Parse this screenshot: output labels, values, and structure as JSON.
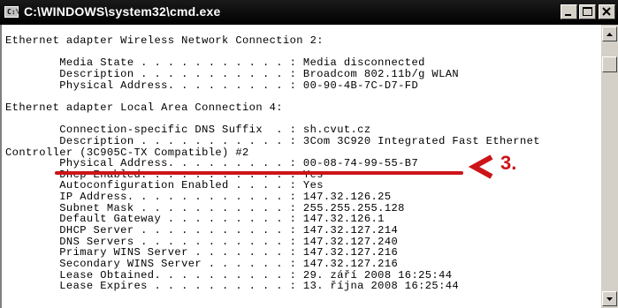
{
  "window": {
    "title": "C:\\WINDOWS\\system32\\cmd.exe",
    "icon": "cmd-icon",
    "icon_text": "C:\\"
  },
  "console": {
    "lines": [
      "Ethernet adapter Wireless Network Connection 2:",
      "",
      "        Media State . . . . . . . . . . . : Media disconnected",
      "        Description . . . . . . . . . . . : Broadcom 802.11b/g WLAN",
      "        Physical Address. . . . . . . . . : 00-90-4B-7C-D7-FD",
      "",
      "Ethernet adapter Local Area Connection 4:",
      "",
      "        Connection-specific DNS Suffix  . : sh.cvut.cz",
      "        Description . . . . . . . . . . . : 3Com 3C920 Integrated Fast Ethernet",
      "Controller (3C905C-TX Compatible) #2",
      "        Physical Address. . . . . . . . . : 00-08-74-99-55-B7",
      "        Dhcp Enabled. . . . . . . . . . . : Yes",
      "        Autoconfiguration Enabled . . . . : Yes",
      "        IP Address. . . . . . . . . . . . : 147.32.126.25",
      "        Subnet Mask . . . . . . . . . . . : 255.255.255.128",
      "        Default Gateway . . . . . . . . . : 147.32.126.1",
      "        DHCP Server . . . . . . . . . . . : 147.32.127.214",
      "        DNS Servers . . . . . . . . . . . : 147.32.127.240",
      "        Primary WINS Server . . . . . . . : 147.32.127.216",
      "        Secondary WINS Server . . . . . . : 147.32.127.216",
      "        Lease Obtained. . . . . . . . . . : 29. září 2008 16:25:44",
      "        Lease Expires . . . . . . . . . . : 13. října 2008 16:25:44"
    ]
  },
  "annotation": {
    "label": "3.",
    "color": "#cc1418"
  },
  "colors": {
    "titlebar": "#000000",
    "console_bg": "#ffffff",
    "console_text": "#000000",
    "chrome": "#d4d0c8"
  }
}
